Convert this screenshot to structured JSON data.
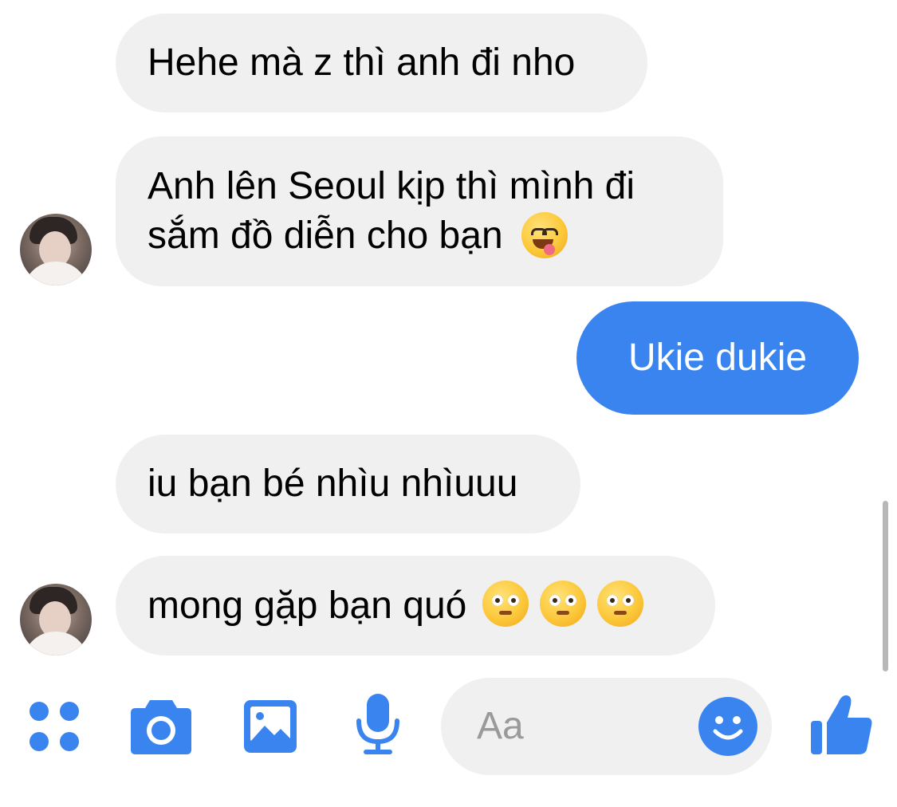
{
  "messages": [
    {
      "direction": "incoming",
      "text": "Hehe mà z thì anh đi nho"
    },
    {
      "direction": "incoming",
      "line1": "Anh lên Seoul kịp thì mình đi",
      "line2": "sắm đồ diễn cho bạn",
      "emoji": "face-savoring-food"
    },
    {
      "direction": "outgoing",
      "text": "Ukie dukie"
    },
    {
      "direction": "incoming",
      "text": "iu bạn bé nhìu nhìuuu"
    },
    {
      "direction": "incoming",
      "text": "mong gặp bạn quó",
      "emoji": "pleading-face",
      "emoji_count": 3
    }
  ],
  "composer": {
    "placeholder": "Aa",
    "icons": [
      "apps-icon",
      "camera-icon",
      "gallery-icon",
      "microphone-icon",
      "emoji-icon",
      "thumbs-up-icon"
    ]
  },
  "colors": {
    "accent": "#3a84ef",
    "incoming_bubble": "#f0f0f0",
    "outgoing_bubble": "#3a84ef"
  }
}
